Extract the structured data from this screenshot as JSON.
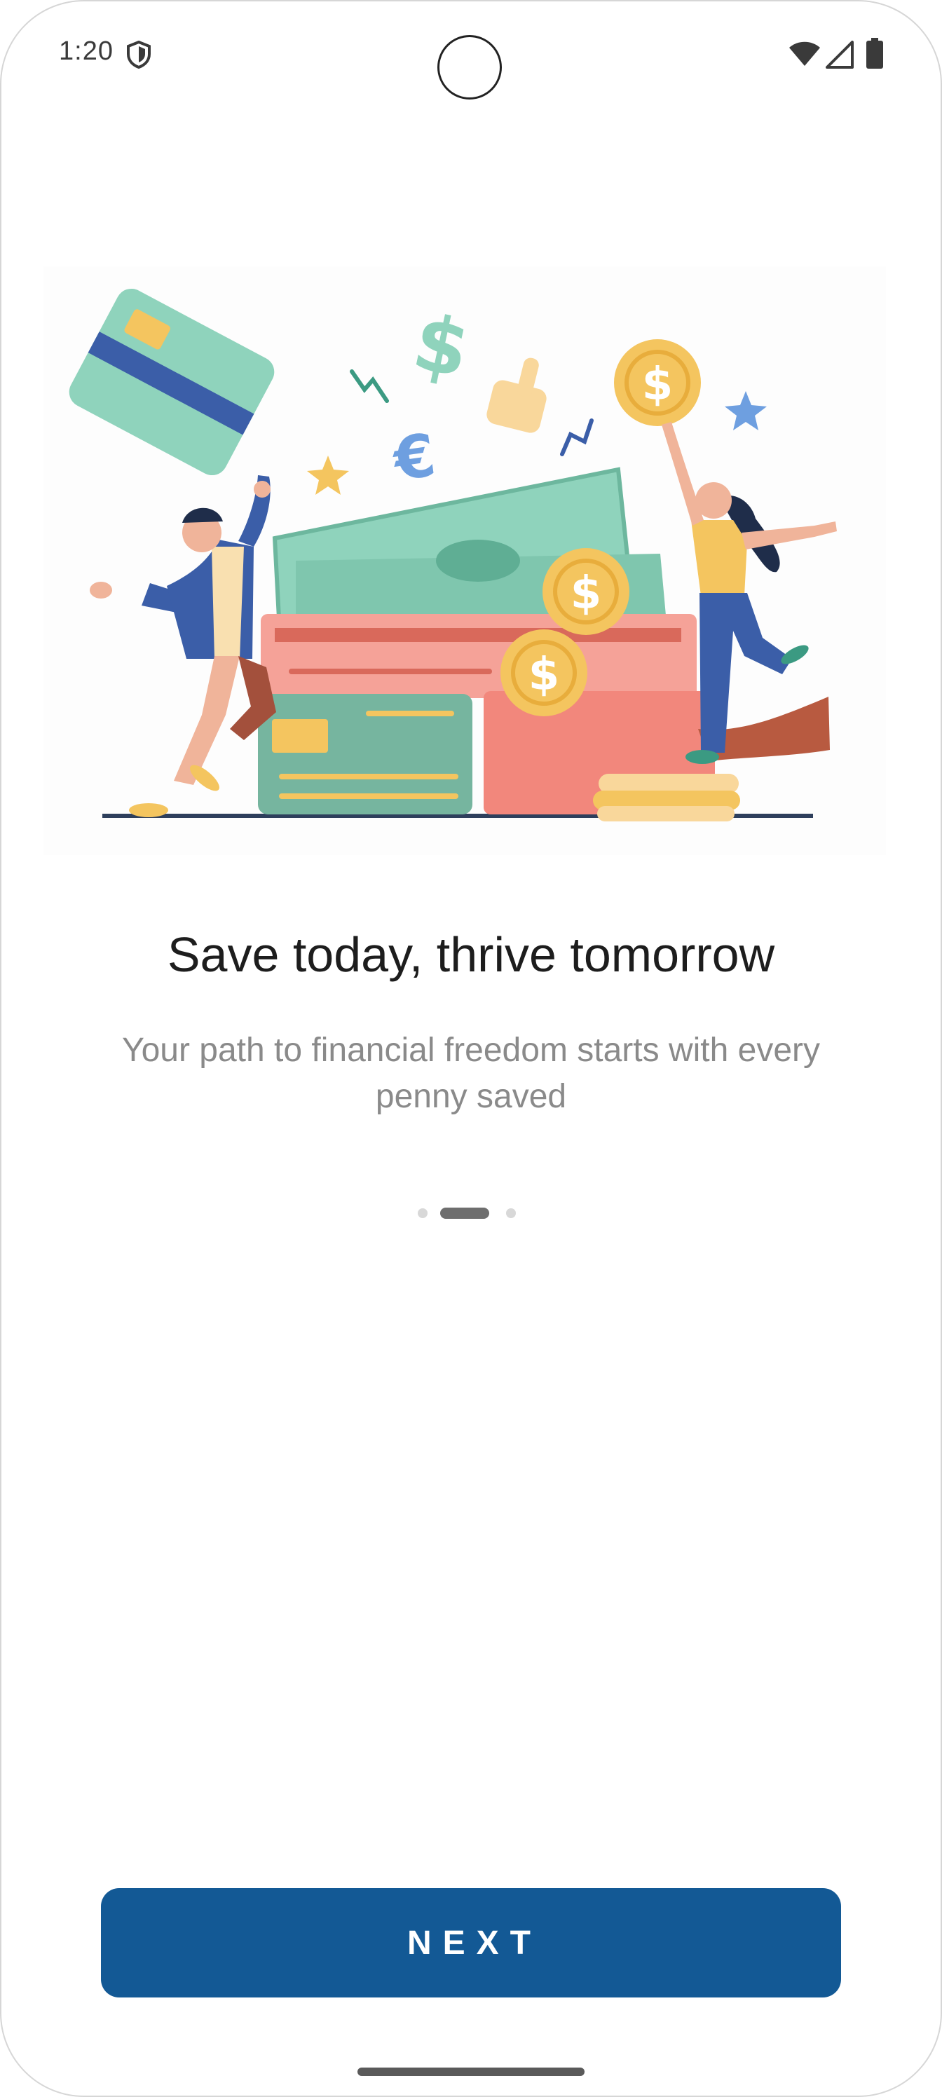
{
  "status_bar": {
    "time": "1:20",
    "icons": [
      "shield-icon",
      "wifi-icon",
      "signal-icon",
      "battery-icon"
    ]
  },
  "illustration": {
    "icon": "savings-illustration",
    "symbols": {
      "dollar": "$",
      "euro": "€"
    }
  },
  "onboarding": {
    "title": "Save today, thrive tomorrow",
    "subtitle": "Your path to financial freedom starts with every penny saved",
    "page_index": 2,
    "page_count": 3
  },
  "actions": {
    "next_label": "NEXT"
  },
  "colors": {
    "primary": "#135995",
    "title_text": "#1d1d1d",
    "subtitle_text": "#8a8a8a",
    "mint": "#8fd3bc",
    "coral": "#f2877c",
    "gold": "#f4c55f",
    "navy": "#3b5ea8"
  }
}
